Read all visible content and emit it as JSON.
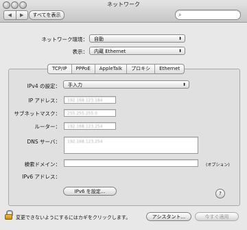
{
  "window": {
    "title": "ネットワーク"
  },
  "toolbar": {
    "back_glyph": "◀",
    "forward_glyph": "▶",
    "show_all_label": "すべてを表示",
    "search_value": "",
    "search_icon": "magnifier-icon"
  },
  "top": {
    "location_label": "ネットワーク環境：",
    "location_value": "自動",
    "show_label": "表示：",
    "show_value": "内蔵 Ethernet"
  },
  "tabs": [
    "TCP/IP",
    "PPPoE",
    "AppleTalk",
    "プロキシ",
    "Ethernet"
  ],
  "tcpip": {
    "ipv4_label": "IPv4 の設定：",
    "ipv4_value": "手入力",
    "ip_label": "IP アドレス：",
    "ip_value": "192.168.123.184",
    "subnet_label": "サブネットマスク：",
    "subnet_value": "255.255.255.0",
    "router_label": "ルーター：",
    "router_value": "192.168.123.254",
    "dns_label": "DNS サーバ：",
    "dns_value": "192.168.123.254",
    "search_domain_label": "検索ドメイン：",
    "search_domain_value": "",
    "optional_label": "(オプション)",
    "ipv6_label": "IPv6 アドレス：",
    "ipv6_button_label": "IPv6 を設定...",
    "help_label": "?"
  },
  "footer": {
    "lock_text": "変更できないようにするにはカギをクリックします。",
    "assistant_label": "アシスタント...",
    "apply_label": "今すぐ適用"
  }
}
